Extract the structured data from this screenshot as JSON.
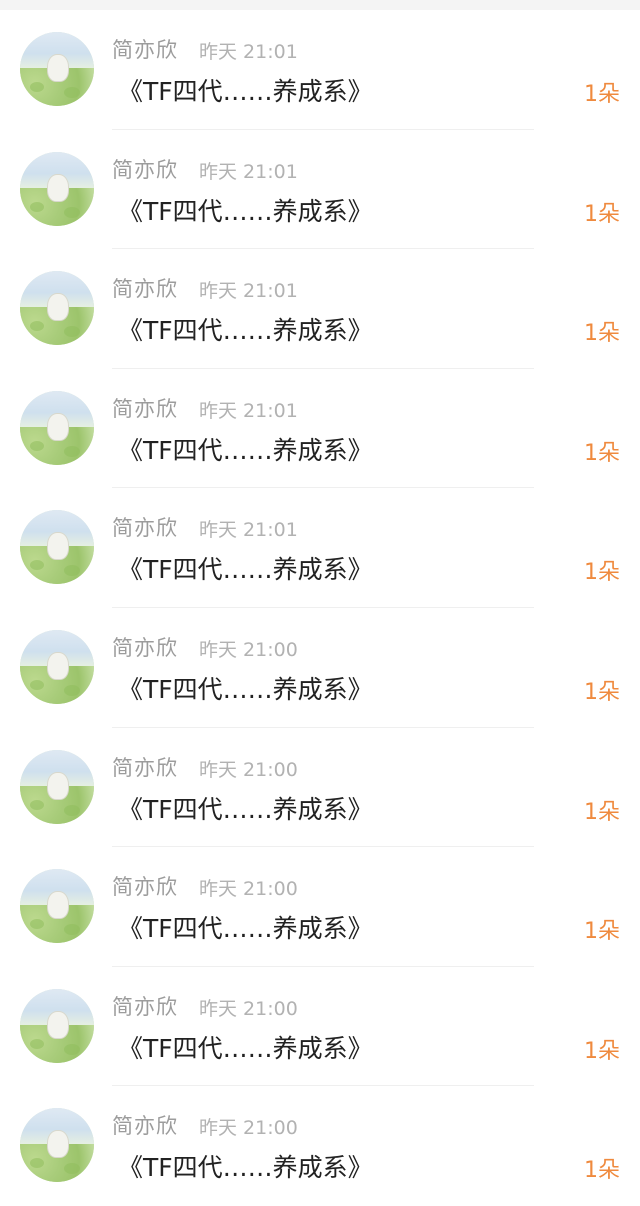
{
  "colors": {
    "name_text": "#9c9c9c",
    "time_text": "#b2b2b2",
    "title_text": "#222222",
    "count_text": "#ef8a3e",
    "background": "#ffffff"
  },
  "items": [
    {
      "name": "简亦欣",
      "time": "昨天 21:01",
      "title": "《TF四代……养成系》",
      "count": "1朵"
    },
    {
      "name": "简亦欣",
      "time": "昨天 21:01",
      "title": "《TF四代……养成系》",
      "count": "1朵"
    },
    {
      "name": "简亦欣",
      "time": "昨天 21:01",
      "title": "《TF四代……养成系》",
      "count": "1朵"
    },
    {
      "name": "简亦欣",
      "time": "昨天 21:01",
      "title": "《TF四代……养成系》",
      "count": "1朵"
    },
    {
      "name": "简亦欣",
      "time": "昨天 21:01",
      "title": "《TF四代……养成系》",
      "count": "1朵"
    },
    {
      "name": "简亦欣",
      "time": "昨天 21:00",
      "title": "《TF四代……养成系》",
      "count": "1朵"
    },
    {
      "name": "简亦欣",
      "time": "昨天 21:00",
      "title": "《TF四代……养成系》",
      "count": "1朵"
    },
    {
      "name": "简亦欣",
      "time": "昨天 21:00",
      "title": "《TF四代……养成系》",
      "count": "1朵"
    },
    {
      "name": "简亦欣",
      "time": "昨天 21:00",
      "title": "《TF四代……养成系》",
      "count": "1朵"
    },
    {
      "name": "简亦欣",
      "time": "昨天 21:00",
      "title": "《TF四代……养成系》",
      "count": "1朵"
    }
  ]
}
